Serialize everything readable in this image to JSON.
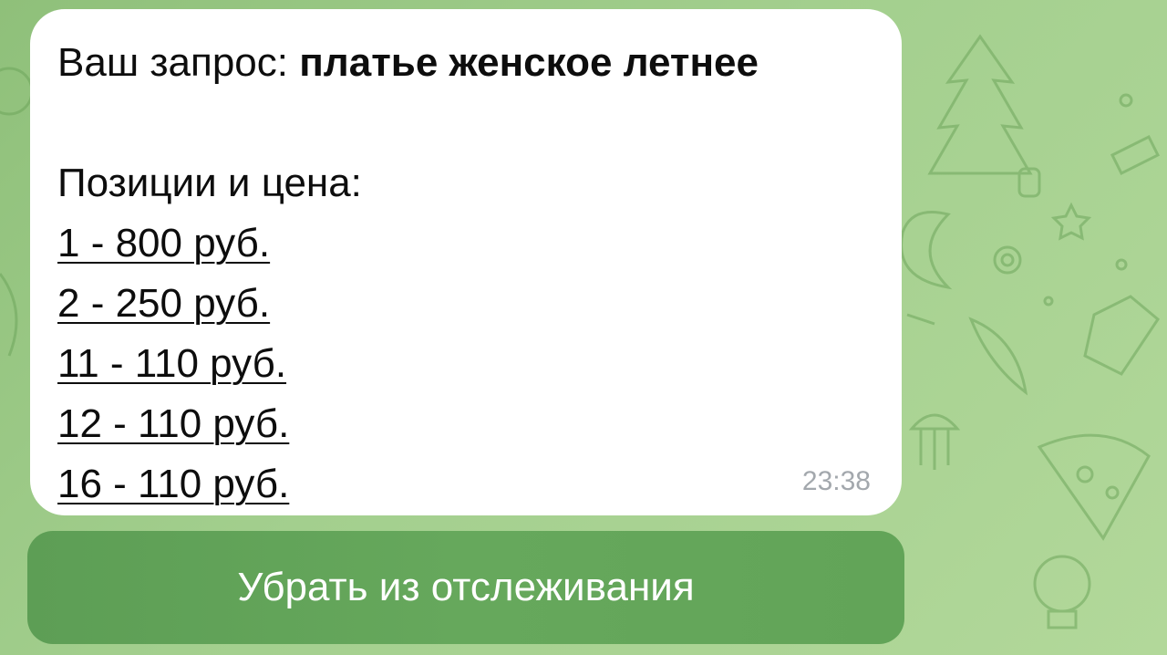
{
  "message": {
    "query_label": "Ваш запрос:",
    "query_value": "платье женское летнее",
    "positions_heading": "Позиции и цена:",
    "positions": [
      "1 - 800 руб.",
      "2 - 250 руб.",
      "11 - 110 руб.",
      "12 - 110 руб.",
      "16 - 110 руб."
    ],
    "time": "23:38"
  },
  "button": {
    "label": "Убрать из отслеживания"
  },
  "colors": {
    "wallpaper": "#9cc987",
    "bubble": "#ffffff",
    "button": "#62a458",
    "time": "#a3a8ad"
  }
}
